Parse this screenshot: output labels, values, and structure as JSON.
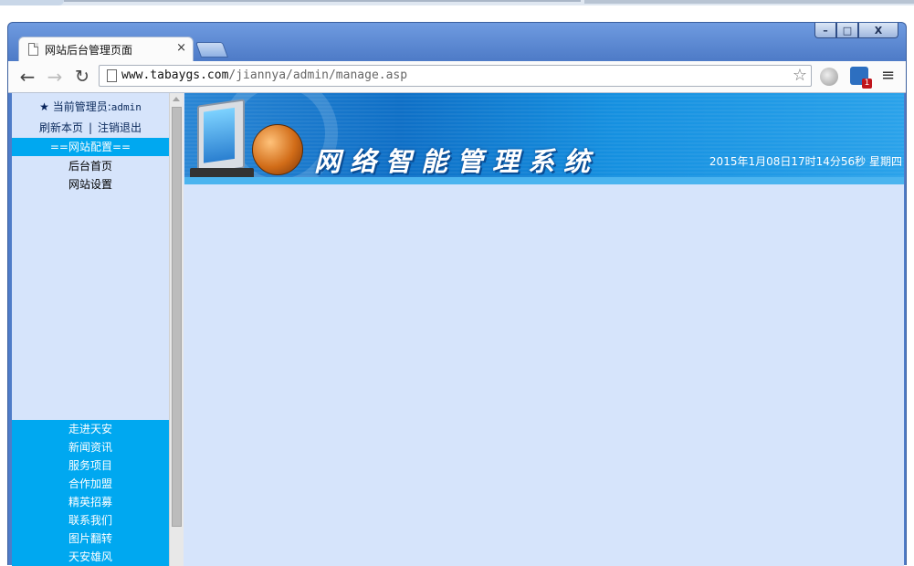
{
  "browser": {
    "tab_title": "网站后台管理页面",
    "tab_close": "×",
    "url_host": "www.tabaygs.com",
    "url_path": "/jiannya/admin/manage.asp",
    "window_minimize": "–",
    "window_maximize": "□",
    "window_close": "X",
    "ext_badge": "1"
  },
  "sidebar": {
    "current_admin_prefix": "当前管理员:",
    "current_admin_user": "admin",
    "refresh_link": "刷新本页",
    "separator": "|",
    "logout_link": "注销退出",
    "section_header": "==网站配置==",
    "section_items": [
      "后台首页",
      "网站设置"
    ],
    "bottom_menu": [
      "走进天安",
      "新闻资讯",
      "服务项目",
      "合作加盟",
      "精英招募",
      "联系我们",
      "图片翻转",
      "天安雄风"
    ]
  },
  "banner": {
    "title": "网络智能管理系统",
    "datetime": "2015年1月08日17时14分56秒 星期四"
  },
  "icons": {
    "back": "back-arrow-icon",
    "forward": "forward-arrow-icon",
    "reload": "reload-icon",
    "star": "bookmark-star-icon",
    "menu": "hamburger-menu-icon"
  }
}
